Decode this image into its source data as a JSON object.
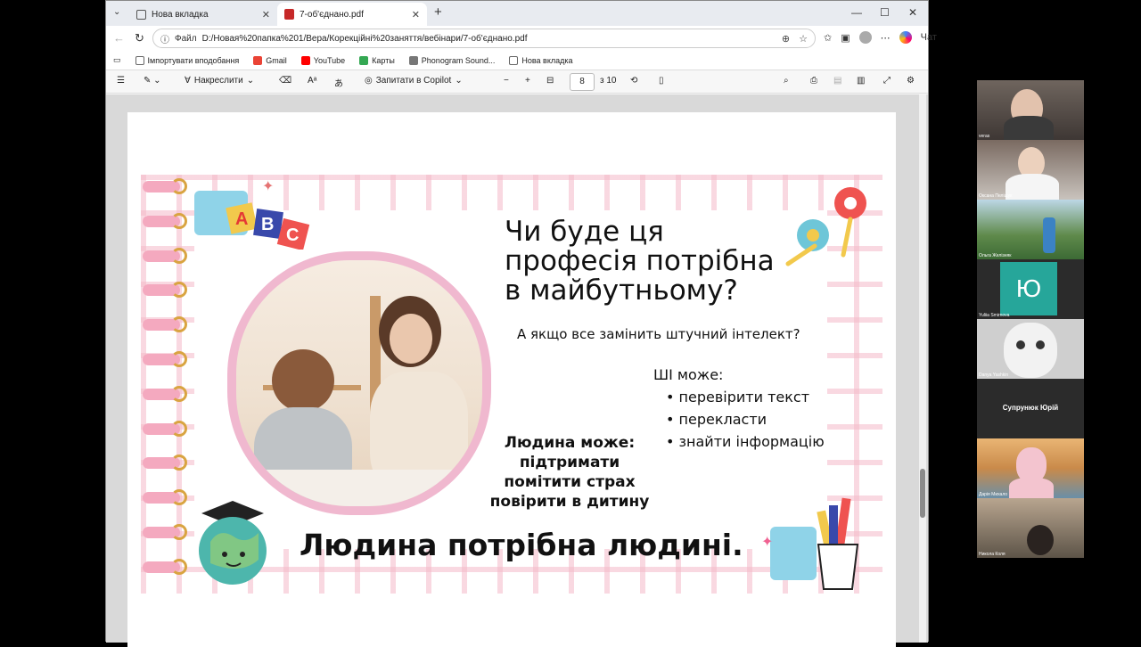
{
  "browser": {
    "tabs": [
      {
        "label": "Нова вкладка",
        "active": false
      },
      {
        "label": "7-об'єднано.pdf",
        "active": true
      }
    ],
    "address": {
      "file_label": "Файл",
      "url": "D:/Новая%20папка%201/Вера/Корекційні%20заняття/вебінари/7-об'єднано.pdf"
    },
    "chat_label": "Чат",
    "bookmarks": [
      {
        "label": "Імпортувати вподобання",
        "icon": "import-icon"
      },
      {
        "label": "Gmail",
        "icon": "gmail-icon"
      },
      {
        "label": "YouTube",
        "icon": "youtube-icon"
      },
      {
        "label": "Карты",
        "icon": "maps-icon"
      },
      {
        "label": "Phonogram Sound...",
        "icon": "phonogram-icon"
      },
      {
        "label": "Нова вкладка",
        "icon": "page-icon"
      }
    ]
  },
  "pdf_toolbar": {
    "draw_label": "Накреслити",
    "copilot_label": "Запитати в Copilot",
    "page_current": "8",
    "page_total": "з 10"
  },
  "slide": {
    "title": "Чи буде ця професія потрібна в майбутньому?",
    "title_lines": [
      "Чи буде ця",
      "професія потрібна",
      "в майбутньому?"
    ],
    "subtitle": "А якщо все замінить штучний інтелект?",
    "ai_heading": "ШІ може:",
    "ai_items": [
      "перевірити текст",
      "перекласти",
      "знайти інформацію"
    ],
    "human_heading": "Людина може:",
    "human_items": [
      "підтримати",
      "помітити страх",
      "повірити в дитину"
    ],
    "conclusion": "Людина потрібна людині.",
    "abc_letters": [
      "A",
      "B",
      "C"
    ]
  },
  "video_participants": [
    {
      "name": "veras"
    },
    {
      "name": "Оксана Пелішук"
    },
    {
      "name": "Ольга Желізняк"
    },
    {
      "name": "Yuliia Smirnova",
      "initial": "Ю"
    },
    {
      "name": "Danya Yashkin"
    },
    {
      "name": "Супрунюк Юрій"
    },
    {
      "name": "Дарія Михало"
    },
    {
      "name": "Никола Коля"
    }
  ],
  "colors": {
    "accent": "#1a73e8",
    "slide_grid": "#f4b9c8",
    "frame_pink": "#f0b8cf",
    "yu_tile": "#26a69a"
  }
}
